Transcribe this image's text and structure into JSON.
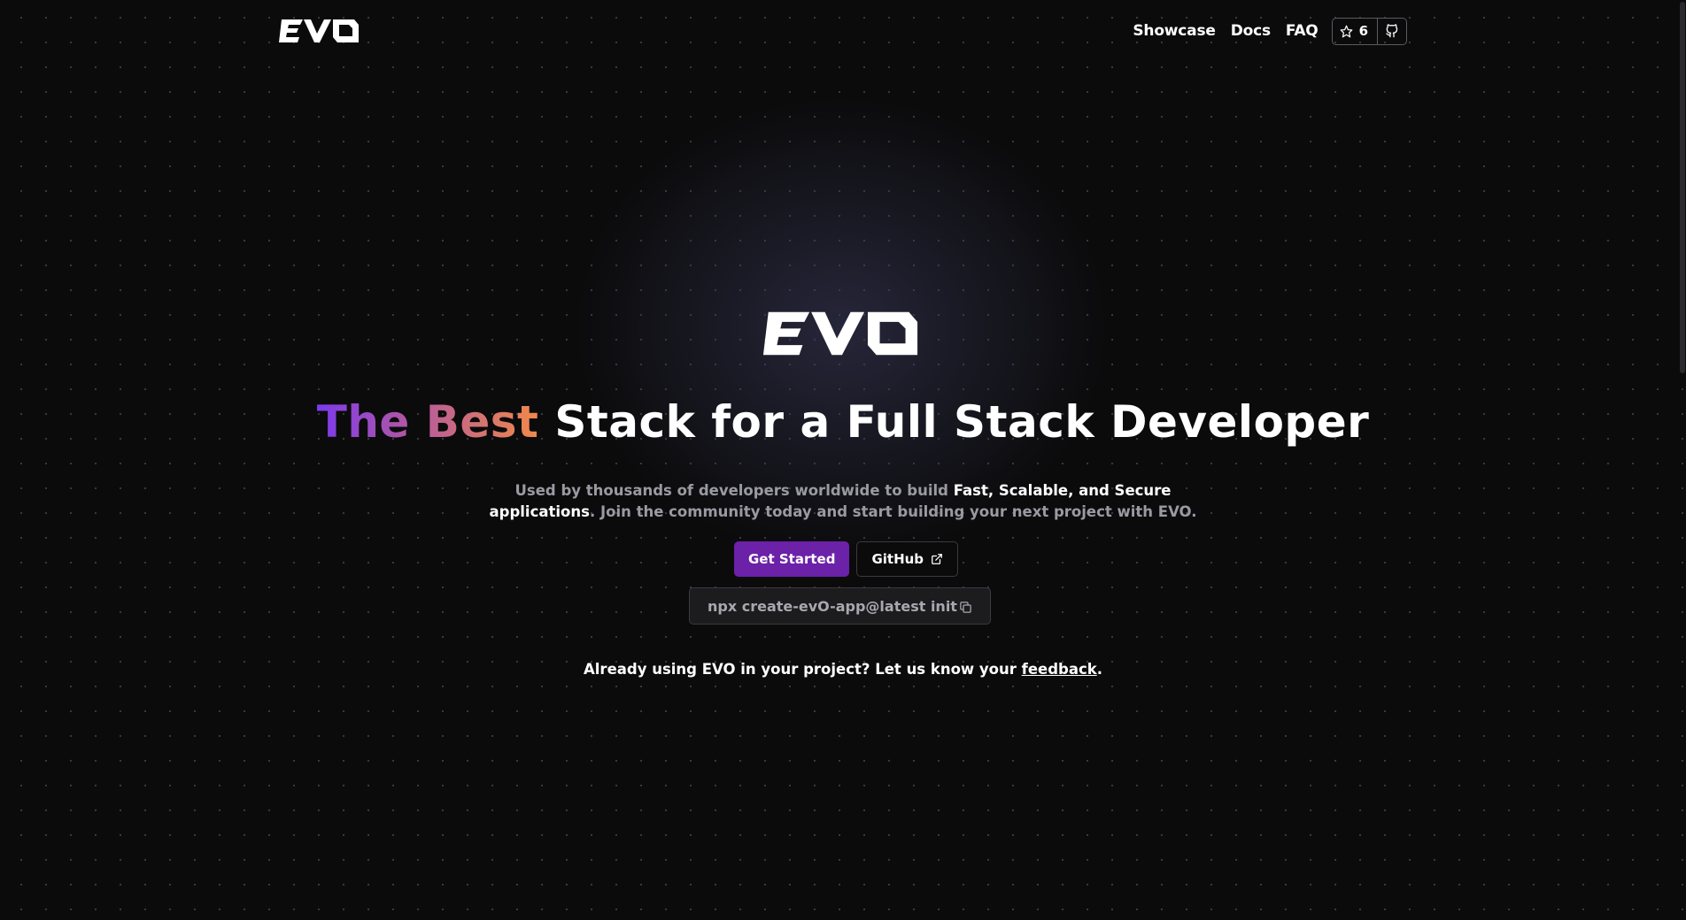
{
  "brand": {
    "logo_text": "EVO"
  },
  "nav": {
    "links": [
      "Showcase",
      "Docs",
      "FAQ"
    ],
    "star_count": "6"
  },
  "hero": {
    "logo_text": "EVO",
    "headline_gradient": "The Best",
    "headline_rest": " Stack for a Full Stack Developer",
    "sub_part1": "Used by thousands of developers worldwide to build ",
    "sub_highlight1": "Fast, Scalable, and Secure",
    "sub_highlight2": "applications",
    "sub_part2": ". Join the community today and start building your next project with EVO.",
    "primary_button": "Get Started",
    "secondary_button": "GitHub",
    "command": "npx create-evO-app@latest init",
    "feedback_prefix": "Already using EVO in your project? Let us know your ",
    "feedback_link": "feedback",
    "feedback_suffix": "."
  },
  "colors": {
    "background": "#0b0b0c",
    "primary": "#6b21a8",
    "gradient_start": "#7c3aed",
    "gradient_end": "#f0894a"
  }
}
